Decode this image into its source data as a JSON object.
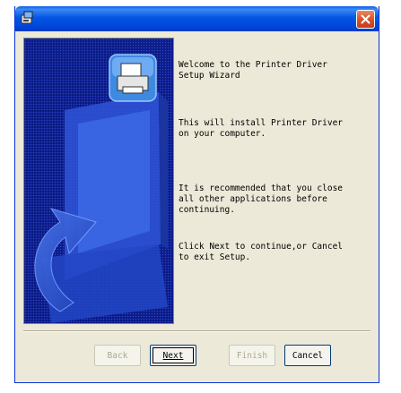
{
  "window": {
    "title": ""
  },
  "welcome": {
    "heading": "Welcome to the Printer Driver\nSetup Wizard",
    "install": "This will install Printer Driver\non your computer.",
    "recommend": "It is recommended that you close\nall other applications before\ncontinuing.",
    "instructions": "Click Next to continue,or Cancel\nto exit Setup."
  },
  "buttons": {
    "back": "Back",
    "next": "Next",
    "finish": "Finish",
    "cancel": "Cancel"
  },
  "icons": {
    "title": "setup-app-icon",
    "close": "close-icon",
    "banner": "printer-banner-icon"
  },
  "colors": {
    "titlebar": "#0456e4",
    "panel": "#0b1a84",
    "dialog": "#ece9d8"
  }
}
